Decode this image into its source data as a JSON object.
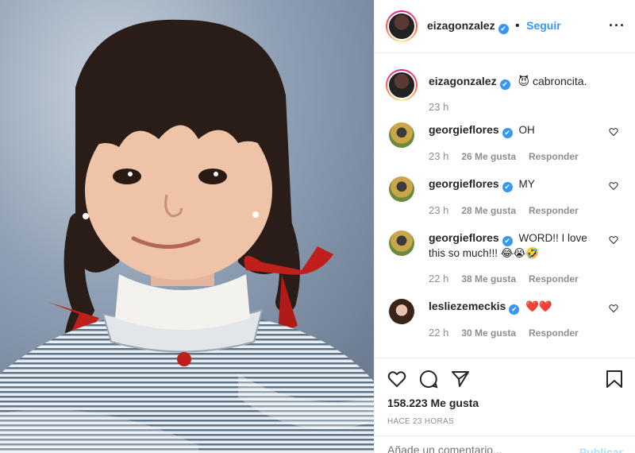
{
  "header": {
    "username": "eizagonzalez",
    "verified_mark": "✔",
    "separator": "•",
    "follow_label": "Seguir",
    "more_label": "···"
  },
  "caption": {
    "username": "eizagonzalez",
    "emoji": "😈",
    "text": "cabroncita.",
    "time": "23 h"
  },
  "comments": [
    {
      "username": "georgieflores",
      "text": "OH",
      "time": "23 h",
      "likes": "26 Me gusta",
      "reply": "Responder"
    },
    {
      "username": "georgieflores",
      "text": "MY",
      "time": "23 h",
      "likes": "28 Me gusta",
      "reply": "Responder"
    },
    {
      "username": "georgieflores",
      "text": "WORD!! I love this so much!!! 😂😭🤣",
      "time": "22 h",
      "likes": "38 Me gusta",
      "reply": "Responder"
    },
    {
      "username": "lesliezemeckis",
      "text": "❤️❤️",
      "time": "22 h",
      "likes": "30 Me gusta",
      "reply": "Responder"
    }
  ],
  "actions": {
    "likes": "158.223 Me gusta",
    "posted": "HACE 23 HORAS"
  },
  "add_comment": {
    "placeholder": "Añade un comentario...",
    "publish": "Publicar"
  },
  "icons": [
    "heart-icon",
    "comment-icon",
    "share-icon",
    "bookmark-icon",
    "ellipsis-icon",
    "verified-icon"
  ],
  "colors": {
    "accent": "#3897f0",
    "muted": "#8e8e8e",
    "text": "#262626",
    "publish_disabled": "#b2dffc"
  }
}
